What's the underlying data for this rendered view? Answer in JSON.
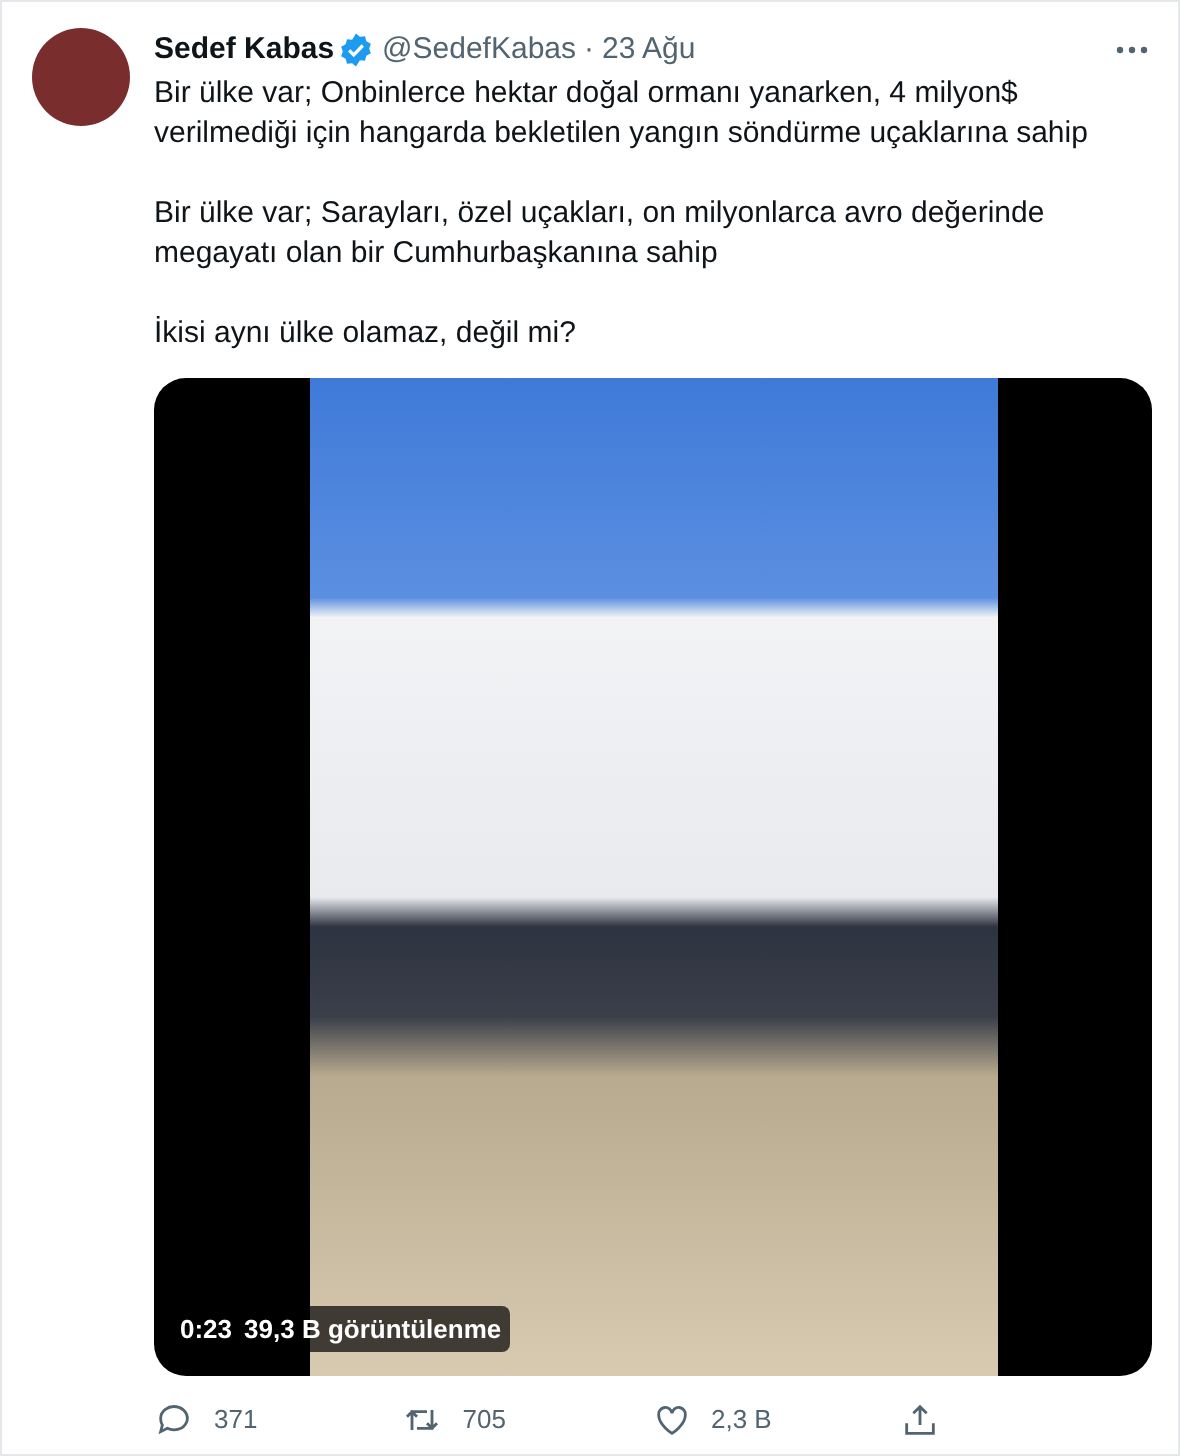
{
  "author": {
    "name": "Sedef Kabas",
    "verified": true,
    "handle": "@SedefKabas",
    "separator": "·",
    "date": "23 Ağu"
  },
  "paragraphs": [
    "Bir ülke var; Onbinlerce hektar doğal ormanı yanarken, 4 milyon$ verilmediği için hangarda bekletilen yangın söndürme uçaklarına sahip",
    "Bir ülke var; Sarayları, özel uçakları, on milyonlarca avro değerinde megayatı olan bir Cumhurbaşkanına sahip",
    "İkisi aynı ülke olamaz, değil mi?"
  ],
  "video": {
    "duration": "0:23",
    "views": "39,3 B görüntülenme"
  },
  "actions": [
    {
      "kind": "reply",
      "count": "371"
    },
    {
      "kind": "retweet",
      "count": "705"
    },
    {
      "kind": "like",
      "count": "2,3 B"
    },
    {
      "kind": "share"
    }
  ]
}
